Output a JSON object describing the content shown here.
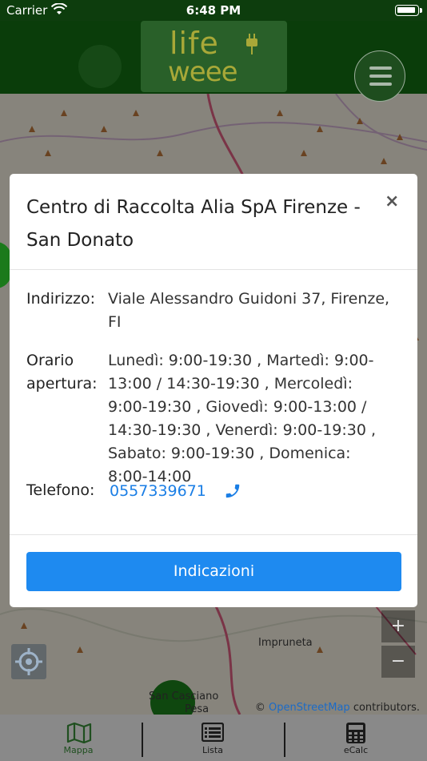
{
  "status_bar": {
    "carrier": "Carrier",
    "time": "6:48 PM"
  },
  "header": {
    "logo_line1": "life",
    "logo_line2": "weee",
    "menu_icon": "hamburger-menu-icon"
  },
  "modal": {
    "title": "Centro di Raccolta Alia SpA Firenze - San Donato",
    "close_label": "×",
    "address_label": "Indirizzo:",
    "address_value": "Viale Alessandro Guidoni 37, Firenze, FI",
    "hours_label_line1": "Orario",
    "hours_label_line2": "apertura:",
    "hours_value": "Lunedì: 9:00-19:30 , Martedì: 9:00-13:00 / 14:30-19:30 , Mercoledì: 9:00-19:30 , Giovedì: 9:00-13:00 / 14:30-19:30 , Venerdì: 9:00-19:30 , Sabato: 9:00-19:30 , Domenica: 8:00-14:00",
    "phone_label": "Telefono:",
    "phone_value": "0557339671",
    "phone_icon": "phone-icon",
    "directions_button": "Indicazioni"
  },
  "map": {
    "zoom_in": "+",
    "zoom_out": "−",
    "place_impruneta": "Impruneta",
    "place_casciano_a": "San Casciano",
    "place_casciano_b": "Pesa",
    "attribution_prefix": "©",
    "attribution_link": "OpenStreetMap",
    "attribution_suffix": "contributors."
  },
  "tabbar": {
    "tabs": [
      {
        "label": "Mappa",
        "icon": "map-icon"
      },
      {
        "label": "Lista",
        "icon": "list-icon"
      },
      {
        "label": "eCalc",
        "icon": "calculator-icon"
      }
    ]
  },
  "colors": {
    "header_green": "#0a3d0a",
    "accent_blue": "#1e8af0",
    "link_blue": "#1a7ee5",
    "logo_olive": "#a8a838"
  }
}
